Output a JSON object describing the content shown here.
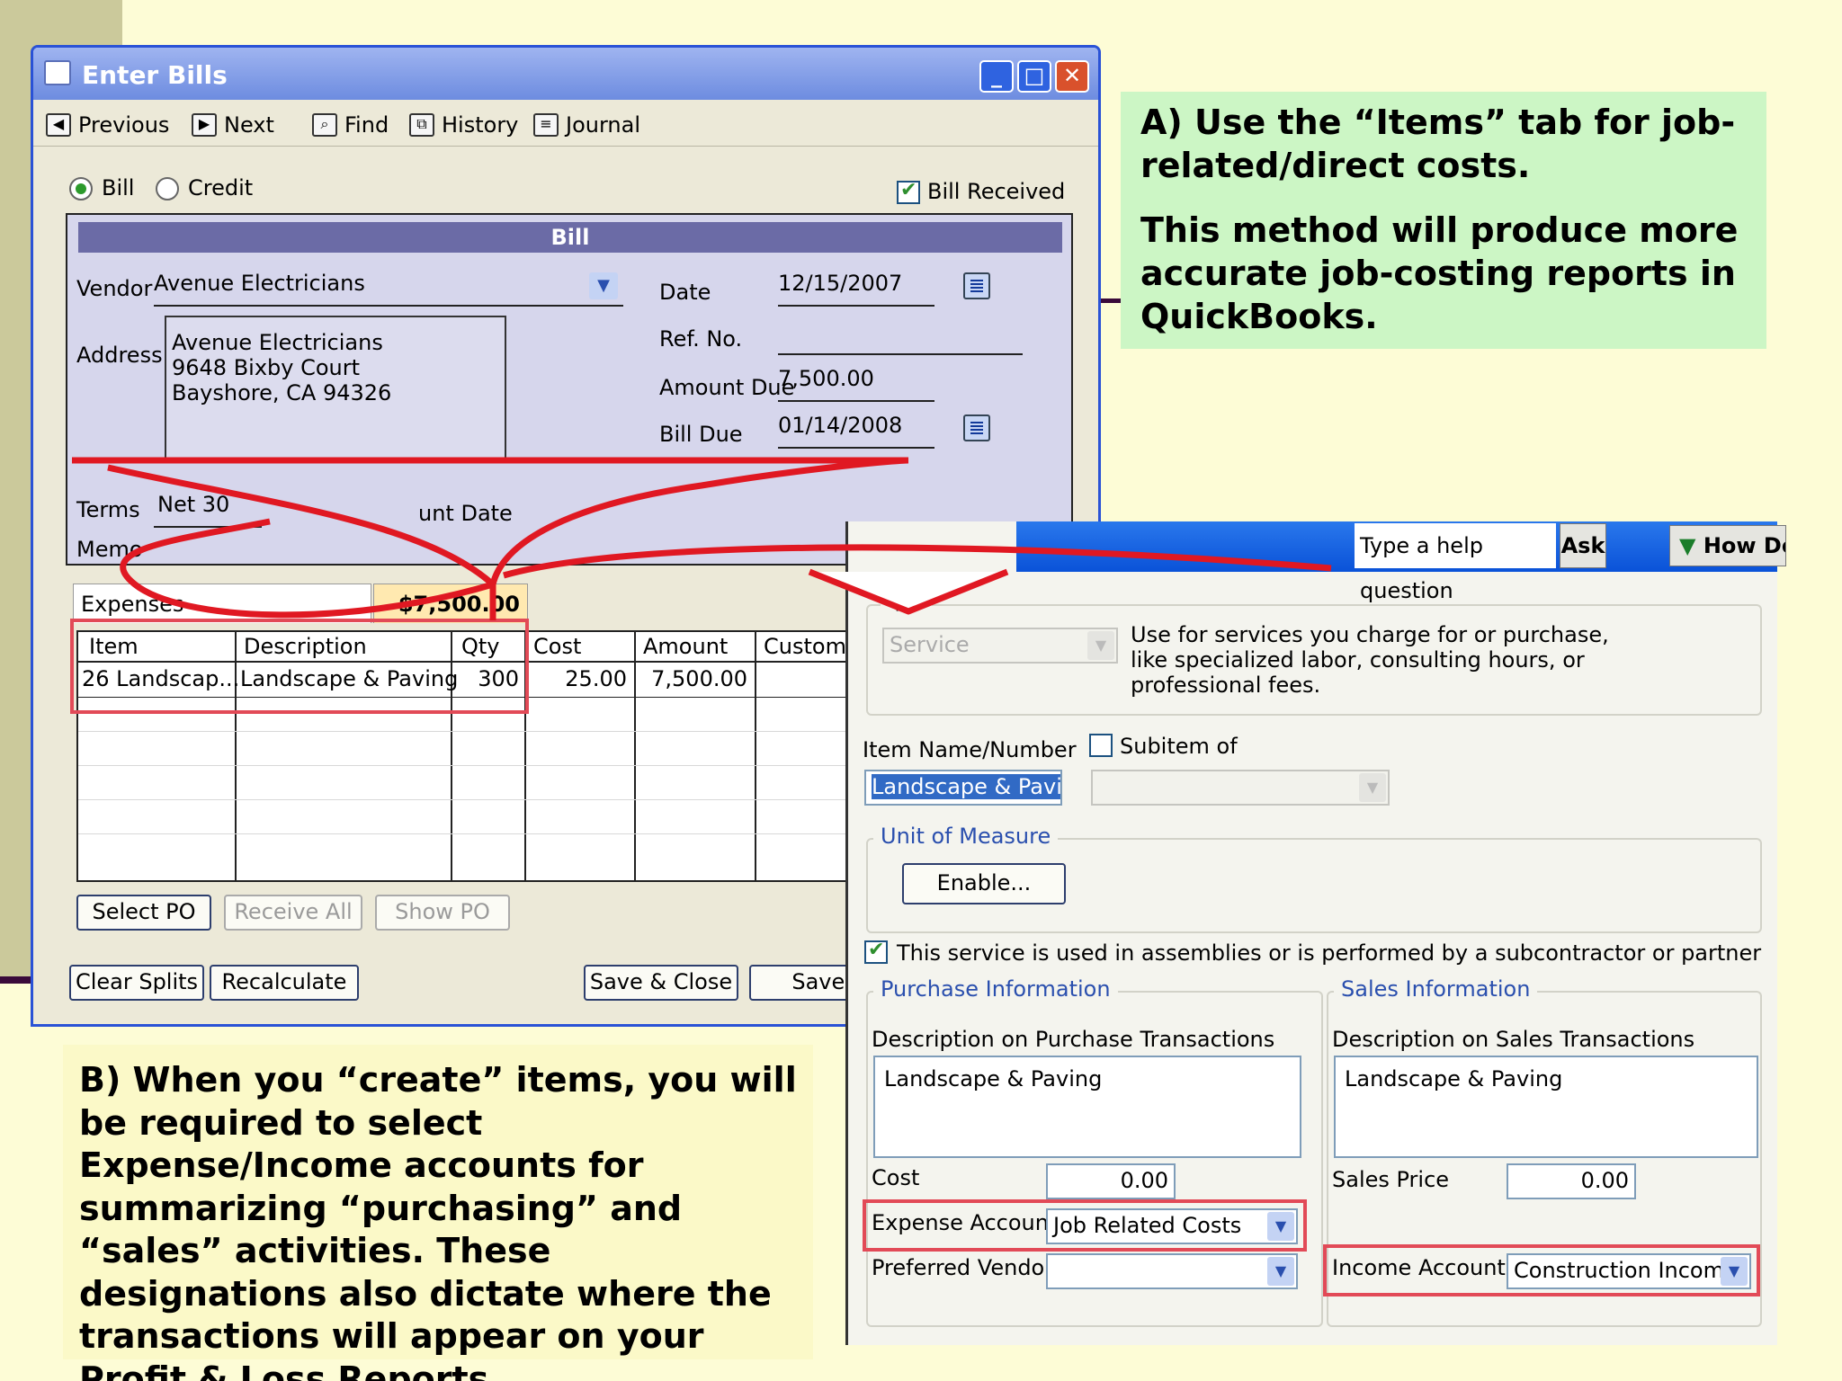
{
  "window": {
    "title": "Enter Bills"
  },
  "toolbar": {
    "previous": "Previous",
    "next": "Next",
    "find": "Find",
    "history": "History",
    "journal": "Journal"
  },
  "bill_type": {
    "bill": "Bill",
    "credit": "Credit",
    "bill_received": "Bill Received"
  },
  "bill": {
    "header": "Bill",
    "vendor_label": "Vendor",
    "vendor": "Avenue Electricians",
    "address_label": "Address",
    "address": [
      "Avenue Electricians",
      "9648 Bixby Court",
      "Bayshore, CA 94326"
    ],
    "date_label": "Date",
    "date": "12/15/2007",
    "ref_label": "Ref. No.",
    "ref": "",
    "amount_due_label": "Amount Due",
    "amount_due": "7,500.00",
    "bill_due_label": "Bill Due",
    "bill_due": "01/14/2008",
    "terms_label": "Terms",
    "terms": "Net 30",
    "discount_label": "unt Date",
    "memo_label": "Memo"
  },
  "tabs": {
    "expenses": "Expenses",
    "items_total": "$7,500.00"
  },
  "grid": {
    "headers": [
      "Item",
      "Description",
      "Qty",
      "Cost",
      "Amount",
      "Custome"
    ],
    "row": [
      "26 Landscap...",
      "Landscape & Paving",
      "300",
      "25.00",
      "7,500.00",
      ""
    ]
  },
  "buttons": {
    "select_po": "Select PO",
    "receive_all": "Receive All",
    "show_po": "Show PO",
    "clear_splits": "Clear Splits",
    "recalculate": "Recalculate",
    "save_close": "Save & Close",
    "save_new": "Save &"
  },
  "callout_a": {
    "line1": "A) Use the “Items” tab for job-related/direct costs.",
    "line2": "This method will produce more accurate job-costing reports in QuickBooks."
  },
  "callout_b": "B) When you “create” items, you will be required to select Expense/Income accounts for summarizing “purchasing” and “sales” activities. These designations also dictate where the transactions will appear on your Profit & Loss Reports.",
  "help": {
    "placeholder": "Type a help question",
    "ask": "Ask",
    "how_do": "How Do"
  },
  "item_form": {
    "type_label": "Type",
    "type_value": "Service",
    "type_description": "Use for services you charge for or purchase, like specialized labor, consulting hours, or professional fees.",
    "item_name_label": "Item Name/Number",
    "item_name": "Landscape & Paving",
    "subitem_label": "Subitem of",
    "subitem_value": "",
    "uom_legend": "Unit of Measure",
    "enable_button": "Enable...",
    "subcontractor_label": "This service is used in assemblies or is performed by a subcontractor or partner",
    "purchase_legend": "Purchase Information",
    "purchase_desc_label": "Description on Purchase Transactions",
    "purchase_desc": "Landscape & Paving",
    "cost_label": "Cost",
    "cost": "0.00",
    "expense_account_label": "Expense Account",
    "expense_account": "Job Related Costs",
    "preferred_vendor_label": "Preferred Vendor",
    "preferred_vendor": "",
    "sales_legend": "Sales Information",
    "sales_desc_label": "Description on Sales Transactions",
    "sales_desc": "Landscape & Paving",
    "sales_price_label": "Sales Price",
    "sales_price": "0.00",
    "income_account_label": "Income Account",
    "income_account": "Construction Income"
  },
  "colors": {
    "highlight": "#e24a57",
    "bill_panel": "#d6d6ec",
    "callout_a": "#ccf6c5",
    "callout_b": "#fbf9c8",
    "titlebar": "#6d8ce0"
  }
}
